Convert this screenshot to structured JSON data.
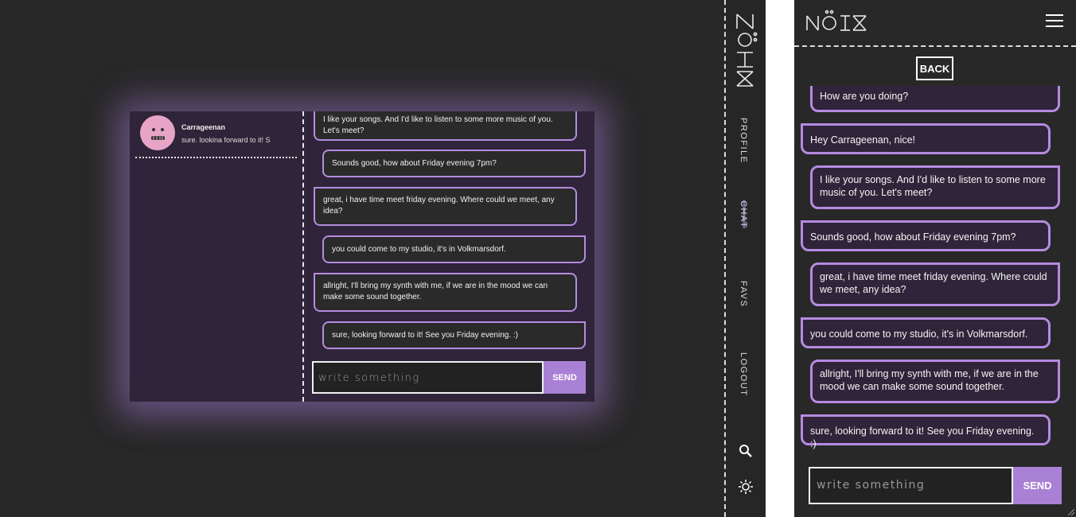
{
  "brand": {
    "logo_text": "NÖIX"
  },
  "desktop": {
    "contact": {
      "name": "Carrageenan",
      "last_message": "sure. lookina forward to it! S"
    },
    "messages": [
      {
        "from": "other",
        "text": "I like your songs. And I'd like to listen to some more music of you. Let's meet?"
      },
      {
        "from": "self",
        "text": "Sounds good, how about Friday evening 7pm?"
      },
      {
        "from": "other",
        "text": "great, i have time meet friday evening. Where could we meet, any idea?"
      },
      {
        "from": "self",
        "text": "you could come to my studio, it's in Volkmarsdorf."
      },
      {
        "from": "other",
        "text": "allright, I'll bring my synth with me, if we are in the mood we can make some sound together."
      },
      {
        "from": "self",
        "text": "sure, looking forward to it! See you Friday evening. :)"
      }
    ],
    "composer": {
      "placeholder": "write something",
      "send_label": "SEND"
    }
  },
  "sidenav": {
    "items": [
      {
        "label": "PROFILE"
      },
      {
        "label": "CHAT"
      },
      {
        "label": "FAVS"
      },
      {
        "label": "LOGOUT"
      }
    ],
    "icons": [
      "search-icon",
      "sun-icon"
    ]
  },
  "mobile": {
    "back_label": "BACK",
    "messages": [
      {
        "from": "self",
        "text": "How are you doing?"
      },
      {
        "from": "other",
        "text": "Hey Carrageenan, nice!"
      },
      {
        "from": "self",
        "text": "I like your songs. And I'd like to listen to some more music of you. Let's meet?"
      },
      {
        "from": "other",
        "text": "Sounds good, how about Friday evening 7pm?"
      },
      {
        "from": "self",
        "text": "great, i have time meet friday evening. Where could we meet, any idea?"
      },
      {
        "from": "other",
        "text": "you could come to my studio, it's in Volkmarsdorf."
      },
      {
        "from": "self",
        "text": "allright, I'll bring my synth with me, if we are in the mood we can make some sound together."
      },
      {
        "from": "other",
        "text": "sure, looking forward to it! See you Friday evening. :)"
      }
    ],
    "composer": {
      "placeholder": "write something",
      "send_label": "SEND"
    }
  },
  "colors": {
    "accent": "#a981d4",
    "bubble_border": "#b58be0",
    "panel": "#2f2439",
    "background": "#282828",
    "avatar": "#e7a4c7"
  }
}
